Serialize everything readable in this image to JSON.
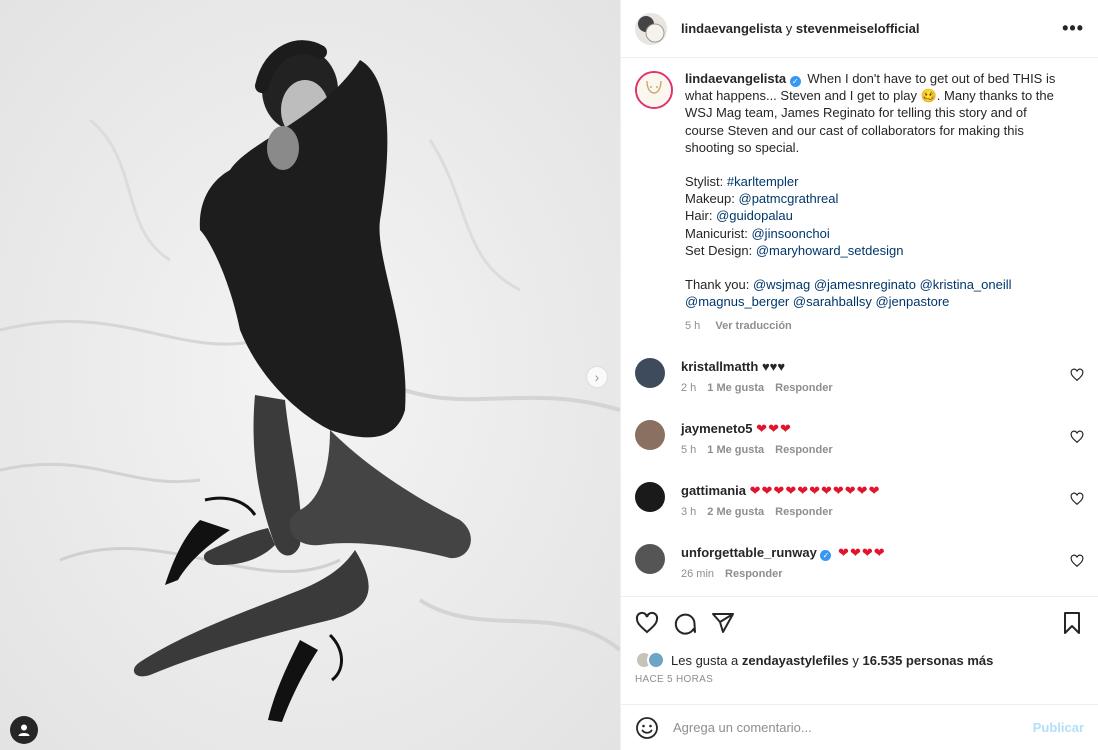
{
  "header": {
    "user1": "lindaevangelista",
    "joiner": "y",
    "user2": "stevenmeiselofficial"
  },
  "caption": {
    "username": "lindaevangelista",
    "line1": "When I don't have to get out of bed THIS is what happens... Steven and I get to play 🥴. Many thanks to the WSJ Mag team, James Reginato for telling this story and of course Steven and our cast of collaborators for making this shooting so special.",
    "credits": [
      {
        "label": "Stylist:",
        "value": "#karltempler"
      },
      {
        "label": "Makeup:",
        "value": "@patmcgrathreal"
      },
      {
        "label": "Hair:",
        "value": "@guidopalau"
      },
      {
        "label": "Manicurist:",
        "value": "@jinsoonchoi"
      },
      {
        "label": "Set Design:",
        "value": "@maryhoward_setdesign"
      }
    ],
    "thanks_label": "Thank you:",
    "thanks": [
      "@wsjmag",
      "@jamesnreginato",
      "@kristina_oneill",
      "@magnus_berger",
      "@sarahballsy",
      "@jenpastore"
    ],
    "time": "5 h",
    "translate": "Ver traducción"
  },
  "comments": [
    {
      "user": "kristallmatth",
      "text": "♥♥♥",
      "time": "2 h",
      "likes": "1 Me gusta",
      "reply": "Responder",
      "verified": false
    },
    {
      "user": "jaymeneto5",
      "text": "❤❤❤",
      "time": "5 h",
      "likes": "1 Me gusta",
      "reply": "Responder",
      "verified": false
    },
    {
      "user": "gattimania",
      "text": "❤❤❤❤❤❤❤❤❤❤❤",
      "time": "3 h",
      "likes": "2 Me gusta",
      "reply": "Responder",
      "verified": false
    },
    {
      "user": "unforgettable_runway",
      "text": "❤❤❤❤",
      "time": "26 min",
      "likes": "",
      "reply": "Responder",
      "verified": true
    }
  ],
  "likes": {
    "prefix": "Les gusta a",
    "user": "zendayastylefiles",
    "middle": "y",
    "count": "16.535 personas más"
  },
  "timestamp": "HACE 5 HORAS",
  "composer": {
    "placeholder": "Agrega un comentario...",
    "publish": "Publicar"
  },
  "icons": {
    "verified": "✓",
    "more": "•••",
    "next": "›"
  },
  "colors": {
    "link": "#00376b",
    "verified": "#3897f0",
    "heart": "#e0142b",
    "publish": "#b2dffc"
  }
}
